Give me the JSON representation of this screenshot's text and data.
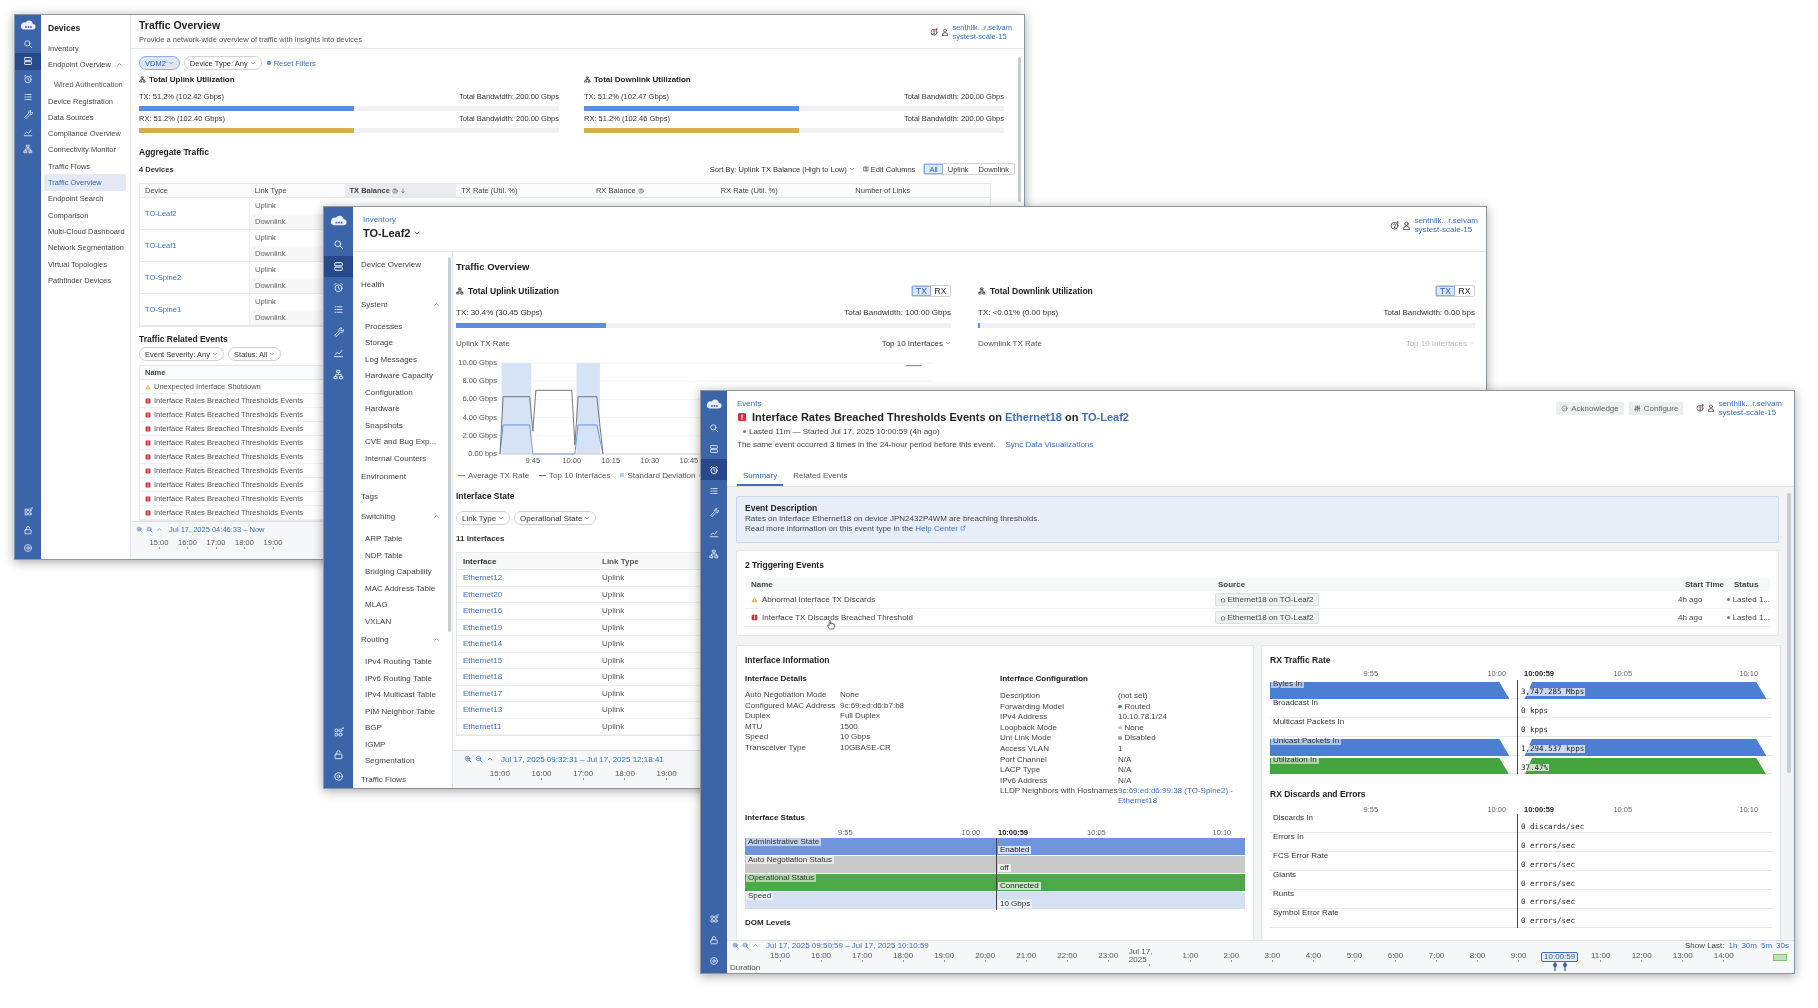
{
  "overview_window": {
    "rail": [
      {
        "selected": false
      },
      {
        "selected": true
      },
      {
        "selected": false
      },
      {
        "selected": false
      },
      {
        "selected": false
      },
      {
        "selected": false
      },
      {
        "selected": false
      }
    ],
    "nav": {
      "title": "Devices",
      "items": [
        {
          "label": "Inventory",
          "selected": false
        },
        {
          "label": "Endpoint Overview",
          "selected": false,
          "expanded": true,
          "children": [
            {
              "label": "Wired Authentication",
              "selected": false
            }
          ]
        },
        {
          "label": "Device Registration",
          "selected": false
        },
        {
          "label": "Data Sources",
          "selected": false
        },
        {
          "label": "Compliance Overview",
          "selected": false
        },
        {
          "label": "Connectivity Monitor",
          "selected": false
        },
        {
          "label": "Traffic Flows",
          "selected": false
        },
        {
          "label": "Traffic Overview",
          "selected": true
        },
        {
          "label": "Endpoint Search",
          "selected": false
        },
        {
          "label": "Comparison",
          "selected": false
        },
        {
          "label": "Multi-Cloud Dashboard",
          "selected": false
        },
        {
          "label": "Network Segmentation",
          "selected": false
        },
        {
          "label": "Virtual Topologies",
          "selected": false
        },
        {
          "label": "Pathfinder Devices",
          "selected": false
        }
      ]
    },
    "title": "Traffic Overview",
    "subtitle": "Provide a network-wide overview of traffic with insights into devices",
    "user": {
      "name": "senthilk...r.selvam",
      "org": "systest-scale-15"
    },
    "filters": [
      {
        "label": "VDM2",
        "selected": true
      },
      {
        "label": "Device Type: Any",
        "selected": false
      }
    ],
    "reset": "Reset Filters",
    "utilization": [
      {
        "title": "Total Uplink Utilization",
        "meters": [
          {
            "reading": "TX: 51.2% (102.42 Gbps)",
            "total": "Total Bandwidth: 200.00 Gbps",
            "level": 0.512,
            "color": "#5b8ee0"
          },
          {
            "reading": "RX: 51.2% (102.40 Gbps)",
            "total": "Total Bandwidth: 200.00 Gbps",
            "level": 0.512,
            "color": "#d8ae4c"
          }
        ]
      },
      {
        "title": "Total Downlink Utilization",
        "meters": [
          {
            "reading": "TX: 51.2% (102.47 Gbps)",
            "total": "Total Bandwidth: 200.00 Gbps",
            "level": 0.512,
            "color": "#5b8ee0"
          },
          {
            "reading": "RX: 51.2% (102.46 Gbps)",
            "total": "Total Bandwidth: 200.00 Gbps",
            "level": 0.512,
            "color": "#d8ae4c"
          }
        ]
      }
    ],
    "aggregate": {
      "title": "Aggregate Traffic",
      "count": "4 Devices",
      "sort": "Sort By: Uplink TX Balance (High to Low)",
      "edit": "Edit Columns",
      "views": [
        {
          "label": "All",
          "selected": true
        },
        {
          "label": "Uplink",
          "selected": false
        },
        {
          "label": "Downlink",
          "selected": false
        }
      ],
      "columns": [
        {
          "label": "Device",
          "info": false,
          "sorted": false
        },
        {
          "label": "Link Type",
          "info": false,
          "sorted": false
        },
        {
          "label": "TX Balance",
          "info": true,
          "sorted": true
        },
        {
          "label": "TX Rate (Util. %)",
          "info": false,
          "sorted": false
        },
        {
          "label": "RX Balance",
          "info": true,
          "sorted": false
        },
        {
          "label": "RX Rate (Util. %)",
          "info": false,
          "sorted": false
        },
        {
          "label": "Number of Links",
          "info": false,
          "sorted": false
        }
      ],
      "rows": [
        {
          "device": "TO-Leaf2",
          "links": [
            "Uplink",
            "Downlink"
          ]
        },
        {
          "device": "TO-Leaf1",
          "links": [
            "Uplink",
            "Downlink"
          ]
        },
        {
          "device": "TO-Spine2",
          "links": [
            "Uplink",
            "Downlink"
          ]
        },
        {
          "device": "TO-Spine1",
          "links": [
            "Uplink",
            "Downlink"
          ]
        }
      ]
    },
    "events": {
      "title": "Traffic Related Events",
      "filters": [
        "Event Severity: Any",
        "Status: All"
      ],
      "column": "Name",
      "rows": [
        {
          "kind": "warning",
          "name": "Unexpected Interface Shutdown"
        },
        {
          "kind": "critical",
          "name": "Interface Rates Breached Thresholds Events"
        },
        {
          "kind": "critical",
          "name": "Interface Rates Breached Thresholds Events"
        },
        {
          "kind": "critical",
          "name": "Interface Rates Breached Thresholds Events"
        },
        {
          "kind": "critical",
          "name": "Interface Rates Breached Thresholds Events"
        },
        {
          "kind": "critical",
          "name": "Interface Rates Breached Thresholds Events"
        },
        {
          "kind": "critical",
          "name": "Interface Rates Breached Thresholds Events"
        },
        {
          "kind": "critical",
          "name": "Interface Rates Breached Thresholds Events"
        },
        {
          "kind": "critical",
          "name": "Interface Rates Breached Thresholds Events"
        },
        {
          "kind": "critical",
          "name": "Interface Rates Breached Thresholds Events"
        }
      ]
    },
    "timeline": {
      "range": "Jul 17, 2025 04:46:33 – Now",
      "ticks": [
        "15:00",
        "16:00",
        "17:00",
        "18:00",
        "19:00"
      ]
    }
  },
  "device_window": {
    "rail": [
      {
        "selected": false
      },
      {
        "selected": true
      },
      {
        "selected": false
      },
      {
        "selected": false
      },
      {
        "selected": false
      },
      {
        "selected": false
      },
      {
        "selected": false
      }
    ],
    "breadcrumb": "Inventory",
    "title": "TO-Leaf2",
    "user": {
      "name": "senthilk...r.selvam",
      "org": "systest-scale-15"
    },
    "nav": [
      {
        "kind": "item",
        "label": "Device Overview",
        "selected": false
      },
      {
        "kind": "item",
        "label": "Health",
        "selected": false
      },
      {
        "kind": "group",
        "label": "System",
        "expanded": true,
        "children": [
          {
            "label": "Processes",
            "selected": false
          },
          {
            "label": "Storage",
            "selected": false
          },
          {
            "label": "Log Messages",
            "selected": false
          },
          {
            "label": "Hardware Capacity",
            "selected": false
          },
          {
            "label": "Configuration",
            "selected": false
          },
          {
            "label": "Hardware",
            "selected": false
          },
          {
            "label": "Snapshots",
            "selected": false
          },
          {
            "label": "CVE and Bug Exp...",
            "selected": false
          },
          {
            "label": "Internal Counters",
            "selected": false
          }
        ]
      },
      {
        "kind": "item",
        "label": "Environment",
        "selected": false
      },
      {
        "kind": "item",
        "label": "Tags",
        "selected": false
      },
      {
        "kind": "group",
        "label": "Switching",
        "expanded": true,
        "children": [
          {
            "label": "ARP Table",
            "selected": false
          },
          {
            "label": "NDP Table",
            "selected": false
          },
          {
            "label": "Bridging Capability",
            "selected": false
          },
          {
            "label": "MAC Address Table",
            "selected": false
          },
          {
            "label": "MLAG",
            "selected": false
          },
          {
            "label": "VXLAN",
            "selected": false
          }
        ]
      },
      {
        "kind": "group",
        "label": "Routing",
        "expanded": true,
        "children": [
          {
            "label": "IPv4 Routing Table",
            "selected": false
          },
          {
            "label": "IPv6 Routing Table",
            "selected": false
          },
          {
            "label": "IPv4 Multicast Table",
            "selected": false
          },
          {
            "label": "PIM Neighbor Table",
            "selected": false
          },
          {
            "label": "BGP",
            "selected": false
          },
          {
            "label": "IGMP",
            "selected": false
          },
          {
            "label": "Segmentation",
            "selected": false
          }
        ]
      },
      {
        "kind": "item",
        "label": "Traffic Flows",
        "selected": false
      }
    ],
    "heading": "Traffic Overview",
    "utilization": [
      {
        "title": "Total Uplink Utilization",
        "toggle": [
          {
            "label": "TX",
            "selected": true
          },
          {
            "label": "RX",
            "selected": false
          }
        ],
        "reading": "TX: 30.4% (30.45 Gbps)",
        "total": "Total Bandwidth: 100.00 Gbps",
        "level": 0.304,
        "rate_title": "Uplink TX Rate",
        "top": {
          "label": "Top 10 Interfaces",
          "disabled": false
        },
        "band": {
          "label": "Standard Deviation"
        },
        "chart_data": {
          "type": "line",
          "grid": true,
          "legend": "bottom",
          "bands": [
            {
              "axis": "x",
              "from": 9.55,
              "to": 9.74
            },
            {
              "axis": "x",
              "from": 10.03,
              "to": 10.18
            }
          ],
          "x": [
            9.54,
            9.56,
            9.73,
            9.75,
            9.77,
            10.0,
            10.02,
            10.04,
            10.16,
            10.2,
            11.0,
            12.1,
            12.14,
            12.24
          ],
          "series": [
            {
              "name": "Average TX Rate",
              "color": "#5b8ee0",
              "values": [
                0,
                3.2,
                3.2,
                0,
                0,
                0,
                0,
                3.2,
                3.2,
                0,
                null,
                null,
                null,
                null
              ]
            },
            {
              "name": "Top 10 Interfaces",
              "color": "#6b6b6b",
              "values": [
                0,
                6.3,
                6.3,
                2.5,
                7,
                7,
                1,
                6.3,
                6.3,
                0,
                null,
                null,
                9.7,
                9.7
              ]
            }
          ],
          "xlim": [
            9.54,
            12.32
          ],
          "ylim": [
            0,
            10
          ],
          "xticks": [
            {
              "value": 9.75,
              "label": "9:45"
            },
            {
              "value": 10,
              "label": "10:00"
            },
            {
              "value": 10.25,
              "label": "10:15"
            },
            {
              "value": 10.5,
              "label": "10:30"
            },
            {
              "value": 10.75,
              "label": "10:45"
            }
          ],
          "yticks": [
            {
              "value": 0,
              "label": "0.00 bps"
            },
            {
              "value": 2,
              "label": "2.00 Gbps"
            },
            {
              "value": 4,
              "label": "4.00 Gbps"
            },
            {
              "value": 6,
              "label": "6.00 Gbps"
            },
            {
              "value": 8,
              "label": "8.00 Gbps"
            },
            {
              "value": 10,
              "label": "10.00 Gbps"
            }
          ]
        }
      },
      {
        "title": "Total Downlink Utilization",
        "toggle": [
          {
            "label": "TX",
            "selected": true
          },
          {
            "label": "RX",
            "selected": false
          }
        ],
        "reading": "TX: <0.01% (0.00 bps)",
        "total": "Total Bandwidth: 0.00 bps",
        "level": 0.005,
        "rate_title": "Downlink TX Rate",
        "top": {
          "label": "Top 10 Interfaces",
          "disabled": true
        }
      }
    ],
    "interface_state": {
      "title": "Interface State",
      "filters": [
        "Link Type",
        "Operational State"
      ],
      "count": "11 Interfaces",
      "columns": [
        "Interface",
        "Link Type"
      ],
      "rows": [
        {
          "interface": "Ethernet12",
          "link_type": "Uplink"
        },
        {
          "interface": "Ethernet20",
          "link_type": "Uplink"
        },
        {
          "interface": "Ethernet16",
          "link_type": "Uplink"
        },
        {
          "interface": "Ethernet19",
          "link_type": "Uplink"
        },
        {
          "interface": "Ethernet14",
          "link_type": "Uplink"
        },
        {
          "interface": "Ethernet15",
          "link_type": "Uplink"
        },
        {
          "interface": "Ethernet18",
          "link_type": "Uplink"
        },
        {
          "interface": "Ethernet17",
          "link_type": "Uplink"
        },
        {
          "interface": "Ethernet13",
          "link_type": "Uplink"
        },
        {
          "interface": "Ethernet11",
          "link_type": "Uplink"
        }
      ]
    },
    "timeline": {
      "range": "Jul 17, 2025 09:32:31 – Jul 17, 2025 12:18:41",
      "ticks": [
        "15:00",
        "16:00",
        "17:00",
        "18:00",
        "19:00"
      ]
    }
  },
  "event_window": {
    "rail": [
      {
        "selected": false
      },
      {
        "selected": false
      },
      {
        "selected": true
      },
      {
        "selected": false
      },
      {
        "selected": false
      },
      {
        "selected": false
      },
      {
        "selected": false
      }
    ],
    "breadcrumb": "Events",
    "title": {
      "kind": "critical",
      "text": "Interface Rates Breached Thresholds Events on ",
      "interface": "Ethernet18",
      "sep": " on ",
      "device": "TO-Leaf2"
    },
    "duration": "Lasted 11m — Started Jul 17, 2025 10:00:59 (4h ago)",
    "note": "The same event occurred 3 times in the 24-hour period before this event.",
    "sync_link": "Sync Data Visualizations",
    "actions": [
      "Acknowledge",
      "Configure"
    ],
    "user": {
      "name": "senthilk...r.selvam",
      "org": "systest-scale-15"
    },
    "tabs": [
      {
        "label": "Summary",
        "selected": true
      },
      {
        "label": "Related Events",
        "selected": false
      }
    ],
    "description": {
      "title": "Event Description",
      "text": "Rates on interface Ethernet18 on device JPN2432P4WM are breaching thresholds.",
      "more": "Read more information on this event type in the ",
      "link": "Help Center"
    },
    "triggering": {
      "title": "2 Triggering Events",
      "columns": [
        "Name",
        "Source",
        "Start Time",
        "Status"
      ],
      "rows": [
        {
          "kind": "warning",
          "name": "Abnormal Interface TX Discards",
          "source": "Ethernet18 on TO-Leaf2",
          "start": "4h ago",
          "status": "Lasted 1..."
        },
        {
          "kind": "critical",
          "name": "Interface TX Discards Breached Threshold",
          "source": "Ethernet18 on TO-Leaf2",
          "start": "4h ago",
          "status": "Lasted 1..."
        }
      ]
    },
    "interface_info": {
      "title": "Interface Information",
      "details_title": "Interface Details",
      "details": [
        {
          "label": "Auto Negotiation Mode",
          "value": "None"
        },
        {
          "label": "Configured MAC Address",
          "value": "9c:69:ed:d6:b7:b8"
        },
        {
          "label": "Duplex",
          "value": "Full Duplex"
        },
        {
          "label": "MTU",
          "value": "1500"
        },
        {
          "label": "Speed",
          "value": "10 Gbps"
        },
        {
          "label": "Transceiver Type",
          "value": "10GBASE-CR"
        }
      ],
      "config_title": "Interface Configuration",
      "config": [
        {
          "kind": "text",
          "label": "Description",
          "value": "(not set)"
        },
        {
          "kind": "status",
          "label": "Forwarding Model",
          "value": "Routed",
          "color": "#43a047"
        },
        {
          "kind": "text",
          "label": "IPv4 Address",
          "value": "10.10.78.1/24"
        },
        {
          "kind": "status",
          "label": "Loopback Mode",
          "value": "None",
          "color": "#c4c4c4"
        },
        {
          "kind": "status",
          "label": "Uni Link Mode",
          "value": "Disabled",
          "color": "#9e9e9e"
        },
        {
          "kind": "text",
          "label": "Access VLAN",
          "value": "1"
        },
        {
          "kind": "text",
          "label": "Port Channel",
          "value": "N/A"
        },
        {
          "kind": "text",
          "label": "LACP Type",
          "value": "N/A"
        },
        {
          "kind": "text",
          "label": "IPv6 Address",
          "value": "N/A"
        },
        {
          "kind": "link",
          "label": "LLDP Neighbors with Hostnames",
          "value": "9c:69:ed:d6:99:38 (TO-Spine2) - Ethernet18"
        }
      ]
    },
    "interface_status": {
      "title": "Interface Status",
      "ticks": [
        "9:55",
        "10:00",
        "10:05",
        "10:10"
      ],
      "cursor": "10:00:59",
      "rows": [
        {
          "label": "Administrative State",
          "value": "Enabled",
          "color": "#6f96dc"
        },
        {
          "label": "Auto Negotiation Status",
          "value": "off",
          "color": "#c9c9c9"
        },
        {
          "label": "Operational Status",
          "value": "Connected",
          "color": "#4caa46"
        },
        {
          "label": "Speed",
          "value": "10 Gbps",
          "color": "#d5e1f3"
        }
      ]
    },
    "dom_title": "DOM Levels",
    "rx_rate": {
      "title": "RX Traffic Rate",
      "ticks": [
        "9:55",
        "10:00",
        "10:05",
        "10:10"
      ],
      "cursor": "10:00:59",
      "rows": [
        {
          "kind": "area",
          "label": "Bytes In",
          "value": "3,747.285 Mbps",
          "color": "#4a7fd4"
        },
        {
          "kind": "flat",
          "label": "Broadcast In",
          "value": "0 kpps"
        },
        {
          "kind": "flat",
          "label": "Multicast Packets In",
          "value": "0 kpps"
        },
        {
          "kind": "area",
          "label": "Unicast Packets In",
          "value": "1,294.537 kpps",
          "color": "#4a7fd4"
        },
        {
          "kind": "area",
          "label": "Utilization In",
          "value": "37.47%",
          "color": "#46a43e"
        }
      ]
    },
    "rx_errors": {
      "title": "RX Discards and Errors",
      "ticks": [
        "9:55",
        "10:00",
        "10:05",
        "10:10"
      ],
      "cursor": "10:00:59",
      "rows": [
        {
          "label": "Discards In",
          "value": "0 discards/sec"
        },
        {
          "label": "Errors In",
          "value": "0 errors/sec"
        },
        {
          "label": "FCS Error Rate",
          "value": "0 errors/sec"
        },
        {
          "label": "Giants",
          "value": "0 errors/sec"
        },
        {
          "label": "Runts",
          "value": "0 errors/sec"
        },
        {
          "label": "Symbol Error Rate",
          "value": "0 errors/sec"
        }
      ]
    },
    "timeline": {
      "range": "Jul 17, 2025 09:50:59 – Jul 17, 2025 10:10:59",
      "show_last": "Show Last:",
      "spans": [
        "1h",
        "30m",
        "5m",
        "30s"
      ],
      "axis_label": "Duration",
      "ticks": [
        {
          "kind": "hour",
          "label": "15:00"
        },
        {
          "kind": "hour",
          "label": "16:00"
        },
        {
          "kind": "hour",
          "label": "17:00"
        },
        {
          "kind": "hour",
          "label": "18:00"
        },
        {
          "kind": "hour",
          "label": "19:00"
        },
        {
          "kind": "hour",
          "label": "20:00"
        },
        {
          "kind": "hour",
          "label": "21:00"
        },
        {
          "kind": "hour",
          "label": "22:00"
        },
        {
          "kind": "hour",
          "label": "23:00"
        },
        {
          "kind": "hour",
          "label": "Jul 17, 2025"
        },
        {
          "kind": "hour",
          "label": "1:00"
        },
        {
          "kind": "hour",
          "label": "2:00"
        },
        {
          "kind": "hour",
          "label": "3:00"
        },
        {
          "kind": "hour",
          "label": "4:00"
        },
        {
          "kind": "hour",
          "label": "5:00"
        },
        {
          "kind": "hour",
          "label": "6:00"
        },
        {
          "kind": "hour",
          "label": "7:00"
        },
        {
          "kind": "hour",
          "label": "8:00"
        },
        {
          "kind": "hour",
          "label": "9:00"
        },
        {
          "kind": "marker",
          "label": "10:00:59"
        },
        {
          "kind": "hour",
          "label": "11:00"
        },
        {
          "kind": "hour",
          "label": "12:00"
        },
        {
          "kind": "hour",
          "label": "13:00"
        },
        {
          "kind": "hour",
          "label": "14:00"
        }
      ]
    }
  }
}
